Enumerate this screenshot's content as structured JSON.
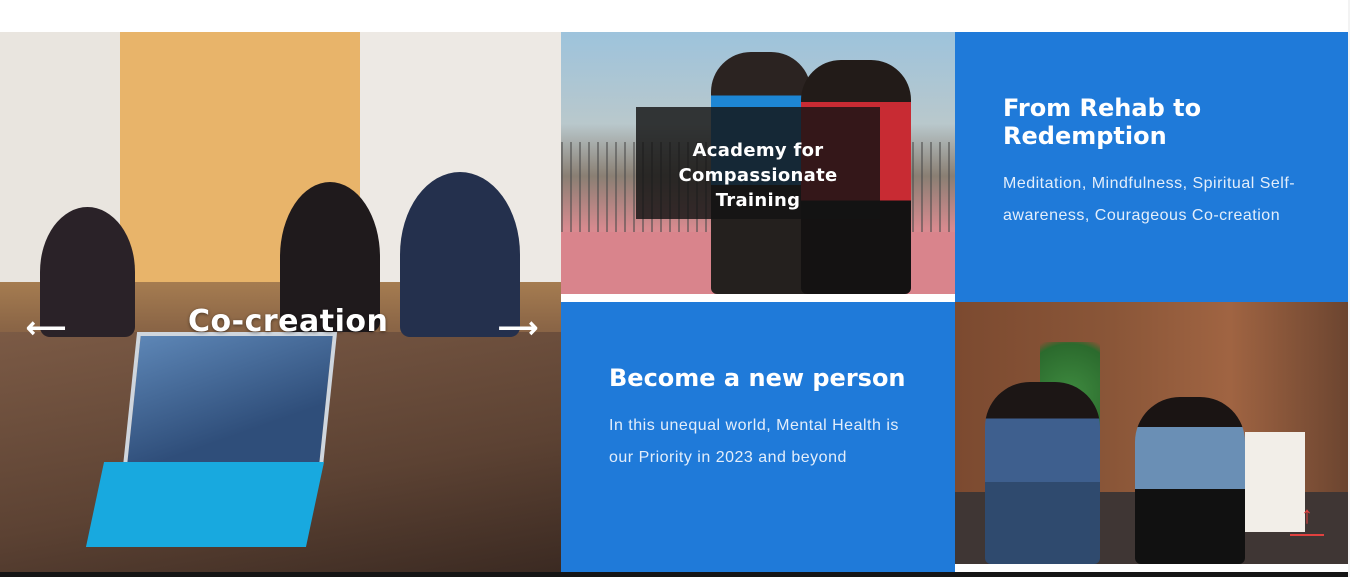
{
  "slider": {
    "caption": "Co-creation",
    "prev_icon": "arrow-left-icon",
    "next_icon": "arrow-right-icon",
    "prev_glyph": "⟵",
    "next_glyph": "⟶"
  },
  "academy": {
    "title": "Academy for Compassionate Training"
  },
  "rehab": {
    "title": "From Rehab to Redemption",
    "text": "Meditation, Mindfulness, Spiritual Self-awareness, Courageous Co-creation"
  },
  "become": {
    "title": "Become a new person",
    "text": "In this unequal world, Mental Health is our Priority in 2023 and beyond"
  },
  "scroll_top": {
    "icon": "arrow-up-icon",
    "glyph": "↑"
  },
  "colors": {
    "tile_blue": "#1f7ad9",
    "scroll_top_red": "#e0413f"
  }
}
